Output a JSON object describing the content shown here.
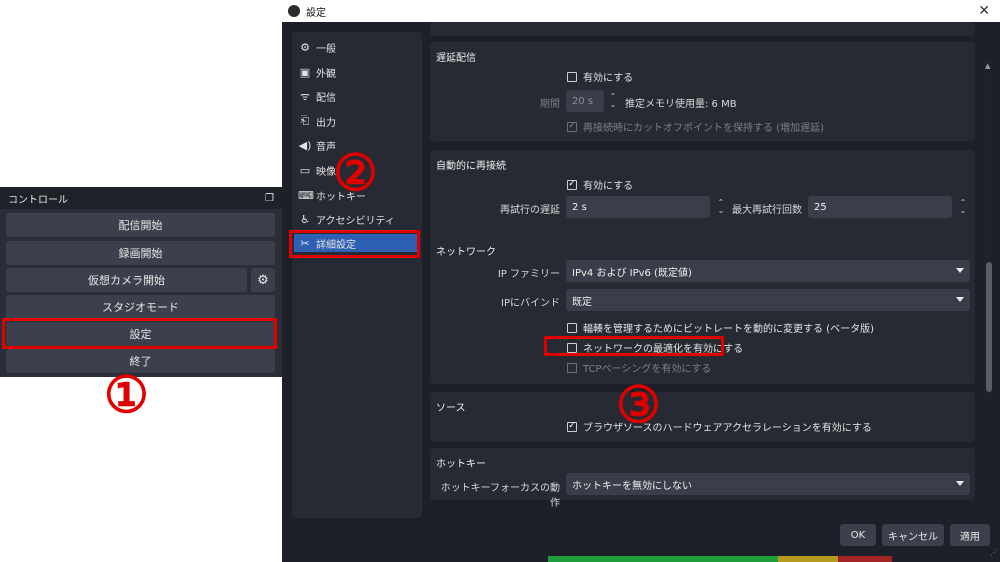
{
  "controls": {
    "title": "コントロール",
    "buttons": {
      "start_stream": "配信開始",
      "start_record": "録画開始",
      "start_virtualcam": "仮想カメラ開始",
      "studio_mode": "スタジオモード",
      "settings": "設定",
      "exit": "終了"
    }
  },
  "markers": {
    "one": "①",
    "two": "②",
    "three": "③"
  },
  "window": {
    "title": "設定",
    "close": "✕"
  },
  "sidebar": {
    "items": [
      {
        "label": "一般",
        "icon": "gear-icon"
      },
      {
        "label": "外観",
        "icon": "palette-icon"
      },
      {
        "label": "配信",
        "icon": "antenna-icon"
      },
      {
        "label": "出力",
        "icon": "output-icon"
      },
      {
        "label": "音声",
        "icon": "speaker-icon"
      },
      {
        "label": "映像",
        "icon": "monitor-icon"
      },
      {
        "label": "ホットキー",
        "icon": "keyboard-icon"
      },
      {
        "label": "アクセシビリティ",
        "icon": "accessibility-icon"
      },
      {
        "label": "詳細設定",
        "icon": "wrench-icon"
      }
    ],
    "active_index": 8
  },
  "delay": {
    "title": "遅延配信",
    "enable": "有効にする",
    "enable_checked": false,
    "duration_label": "期間",
    "duration_value": "20 s",
    "memory_note": "推定メモリ使用量: 6 MB",
    "preserve": "再接続時にカットオフポイントを保持する (増加遅延)",
    "preserve_checked": true
  },
  "reconnect": {
    "title": "自動的に再接続",
    "enable": "有効にする",
    "enable_checked": true,
    "retry_delay_label": "再試行の遅延",
    "retry_delay_value": "2 s",
    "max_retries_label": "最大再試行回数",
    "max_retries_value": "25"
  },
  "network": {
    "title": "ネットワーク",
    "ip_family_label": "IP ファミリー",
    "ip_family_value": "IPv4 および IPv6 (既定値)",
    "bind_ip_label": "IPにバインド",
    "bind_ip_value": "既定",
    "dynamic_bitrate": "輻輳を管理するためにビットレートを動的に変更する (ベータ版)",
    "dynamic_bitrate_checked": false,
    "network_optimize": "ネットワークの最適化を有効にする",
    "network_optimize_checked": false,
    "tcp_pacing": "TCPペーシングを有効にする",
    "tcp_pacing_checked": false
  },
  "sources": {
    "title": "ソース",
    "browser_hw_accel": "ブラウザソースのハードウェアアクセラレーションを有効にする",
    "browser_hw_accel_checked": true
  },
  "hotkeys": {
    "title": "ホットキー",
    "focus_label": "ホットキーフォーカスの動作",
    "focus_value": "ホットキーを無効にしない"
  },
  "footer": {
    "ok": "OK",
    "cancel": "キャンセル",
    "apply": "適用"
  },
  "colors": {
    "highlight": "#e00000",
    "active": "#2d5fb3"
  }
}
